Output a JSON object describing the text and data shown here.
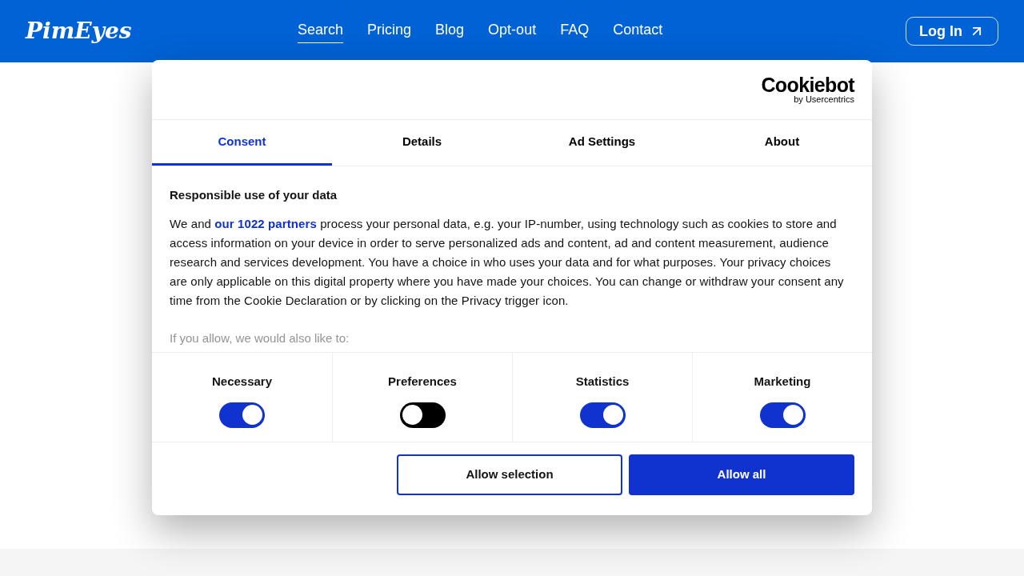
{
  "header": {
    "logo": "PimEyes",
    "nav": [
      {
        "label": "Search",
        "selected": true
      },
      {
        "label": "Pricing",
        "selected": false
      },
      {
        "label": "Blog",
        "selected": false
      },
      {
        "label": "Opt-out",
        "selected": false
      },
      {
        "label": "FAQ",
        "selected": false
      },
      {
        "label": "Contact",
        "selected": false
      }
    ],
    "login": "Log In"
  },
  "dialog": {
    "brand": "Cookiebot",
    "brand_sub": "by Usercentrics",
    "tabs": [
      {
        "label": "Consent",
        "selected": true
      },
      {
        "label": "Details",
        "selected": false
      },
      {
        "label": "Ad Settings",
        "selected": false
      },
      {
        "label": "About",
        "selected": false
      }
    ],
    "heading": "Responsible use of your data",
    "body_before": "We and ",
    "body_link": "our 1022 partners",
    "body_after": " process your personal data, e.g. your IP-number, using technology such as cookies to store and access information on your device in order to serve personalized ads and content, ad and content measurement, audience research and services development. You have a choice in who uses your data and for what purposes. Your privacy choices are only applicable on this digital property where you have made your choices. You can change or withdraw your consent any time from the Cookie Declaration or by clicking on the Privacy trigger icon.",
    "faded": "If you allow, we would also like to:",
    "toggles": [
      {
        "label": "Necessary",
        "on": true
      },
      {
        "label": "Preferences",
        "on": false
      },
      {
        "label": "Statistics",
        "on": true
      },
      {
        "label": "Marketing",
        "on": true
      }
    ],
    "buttons": [
      {
        "label": "Allow selection",
        "kind": "outline"
      },
      {
        "label": "Allow all",
        "kind": "filled"
      }
    ]
  }
}
